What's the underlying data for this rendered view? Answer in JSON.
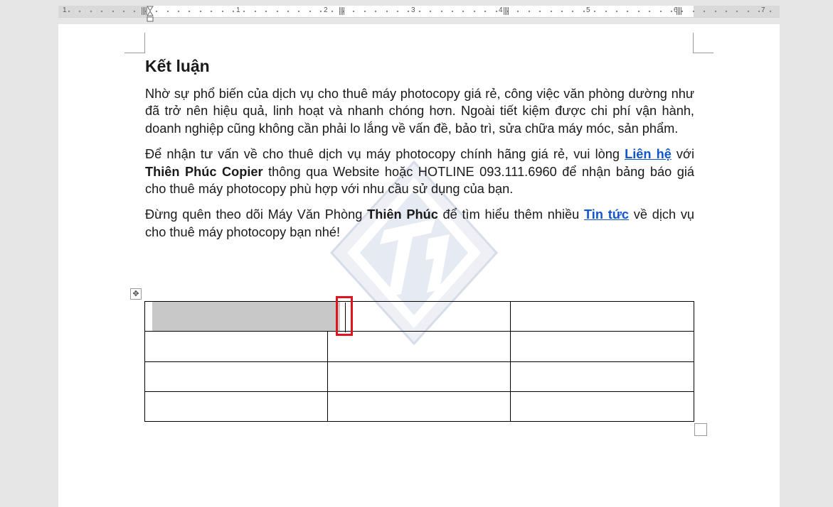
{
  "ruler": {
    "numbers": [
      "1",
      "1",
      "2",
      "3",
      "4",
      "5",
      "6",
      "7"
    ]
  },
  "document": {
    "heading": "Kết luận",
    "para1": "Nhờ sự phổ biến của dịch vụ cho thuê máy photocopy giá rẻ, công việc văn phòng dường như đã trở nên hiệu quả, linh hoạt và nhanh chóng hơn. Ngoài tiết kiệm được chi phí vận hành, doanh nghiệp cũng không cần phải lo lắng về vấn đề, bảo trì, sửa chữa máy móc, sản phẩm.",
    "para2": {
      "before_link": "Để nhận tư vấn về cho thuê dịch vụ máy photocopy chính hãng giá rẻ, vui lòng ",
      "link": "Liên hệ",
      "middle": " với ",
      "bold": "Thiên Phúc Copier",
      "after": " thông qua Website hoặc HOTLINE 093.111.6960 để nhận bảng báo giá cho thuê máy photocopy phù hợp với nhu cầu sử dụng của bạn."
    },
    "para3": {
      "before_bold": "Đừng quên theo dõi Máy Văn Phòng ",
      "bold": "Thiên Phúc",
      "middle": " để tìm hiểu thêm nhiều ",
      "link": "Tin tức",
      "after": " về dịch vụ cho thuê máy photocopy bạn nhé!"
    },
    "table": {
      "rows": 4,
      "columns": 3,
      "move_handle_icon": "move-icon"
    }
  },
  "colors": {
    "link": "#1155cc",
    "highlight_box": "#e0141e",
    "selection": "#c8c8c8"
  }
}
